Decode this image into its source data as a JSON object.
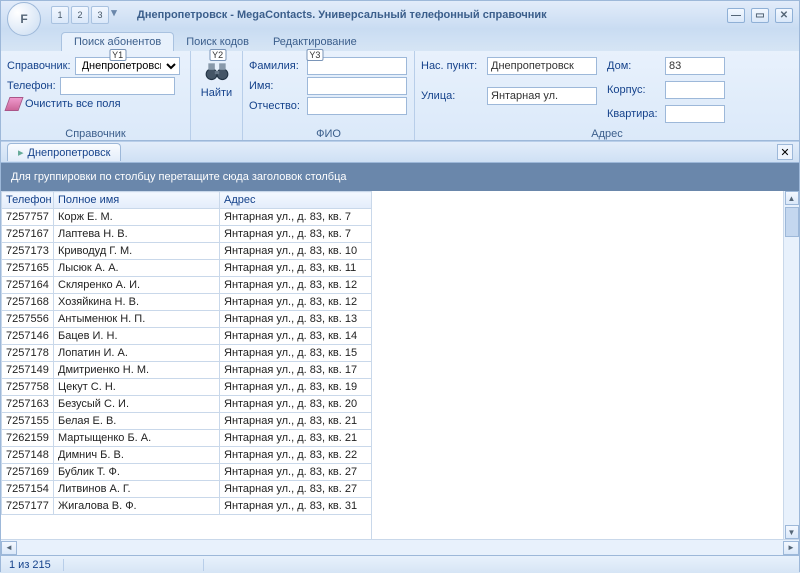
{
  "window": {
    "title": "Днепропетровск - MegaContacts. Универсальный телефонный справочник",
    "logo_letter": "F",
    "qat": [
      "1",
      "2",
      "3"
    ]
  },
  "ribbon_tabs": [
    {
      "label": "Поиск абонентов",
      "shortcut": "Y1",
      "active": true
    },
    {
      "label": "Поиск кодов",
      "shortcut": "Y2",
      "active": false
    },
    {
      "label": "Редактирование",
      "shortcut": "Y3",
      "active": false
    }
  ],
  "panel": {
    "spravochnik": {
      "label_dir": "Справочник:",
      "dir_value": "Днепропетровск",
      "label_tel": "Телефон:",
      "tel_value": "",
      "clear": "Очистить все поля",
      "group": "Справочник"
    },
    "find": "Найти",
    "fio": {
      "group": "ФИО",
      "lastname_lbl": "Фамилия:",
      "lastname": "",
      "firstname_lbl": "Имя:",
      "firstname": "",
      "patronym_lbl": "Отчество:",
      "patronym": ""
    },
    "address": {
      "group": "Адрес",
      "city_lbl": "Нас. пункт:",
      "city": "Днепропетровск",
      "street_lbl": "Улица:",
      "street": "Янтарная ул.",
      "house_lbl": "Дом:",
      "house": "83",
      "korpus_lbl": "Корпус:",
      "korpus": "",
      "flat_lbl": "Квартира:",
      "flat": ""
    }
  },
  "docTab": "Днепропетровск",
  "grouping_hint": "Для группировки по столбцу перетащите сюда заголовок столбца",
  "columns": [
    "Телефон",
    "Полное имя",
    "Адрес"
  ],
  "rows": [
    {
      "tel": "7257757",
      "name": "Корж Е. М.",
      "addr": "Янтарная ул., д. 83, кв. 7"
    },
    {
      "tel": "7257167",
      "name": "Лаптева Н. В.",
      "addr": "Янтарная ул., д. 83, кв. 7"
    },
    {
      "tel": "7257173",
      "name": "Криводуд Г. М.",
      "addr": "Янтарная ул., д. 83, кв. 10"
    },
    {
      "tel": "7257165",
      "name": "Лысюк А. А.",
      "addr": "Янтарная ул., д. 83, кв. 11"
    },
    {
      "tel": "7257164",
      "name": "Скляренко А. И.",
      "addr": "Янтарная ул., д. 83, кв. 12"
    },
    {
      "tel": "7257168",
      "name": "Хозяйкина Н. В.",
      "addr": "Янтарная ул., д. 83, кв. 12"
    },
    {
      "tel": "7257556",
      "name": "Антыменюк Н. П.",
      "addr": "Янтарная ул., д. 83, кв. 13"
    },
    {
      "tel": "7257146",
      "name": "Бацев И. Н.",
      "addr": "Янтарная ул., д. 83, кв. 14"
    },
    {
      "tel": "7257178",
      "name": "Лопатин И. А.",
      "addr": "Янтарная ул., д. 83, кв. 15"
    },
    {
      "tel": "7257149",
      "name": "Дмитриенко Н. М.",
      "addr": "Янтарная ул., д. 83, кв. 17"
    },
    {
      "tel": "7257758",
      "name": "Цекут С. Н.",
      "addr": "Янтарная ул., д. 83, кв. 19"
    },
    {
      "tel": "7257163",
      "name": "Безусый С. И.",
      "addr": "Янтарная ул., д. 83, кв. 20"
    },
    {
      "tel": "7257155",
      "name": "Белая Е. В.",
      "addr": "Янтарная ул., д. 83, кв. 21"
    },
    {
      "tel": "7262159",
      "name": "Мартыщенко Б. А.",
      "addr": "Янтарная ул., д. 83, кв. 21"
    },
    {
      "tel": "7257148",
      "name": "Димнич Б. В.",
      "addr": "Янтарная ул., д. 83, кв. 22"
    },
    {
      "tel": "7257169",
      "name": "Бублик Т. Ф.",
      "addr": "Янтарная ул., д. 83, кв. 27"
    },
    {
      "tel": "7257154",
      "name": "Литвинов А. Г.",
      "addr": "Янтарная ул., д. 83, кв. 27"
    },
    {
      "tel": "7257177",
      "name": "Жигалова В. Ф.",
      "addr": "Янтарная ул., д. 83, кв. 31"
    }
  ],
  "status": "1 из 215"
}
